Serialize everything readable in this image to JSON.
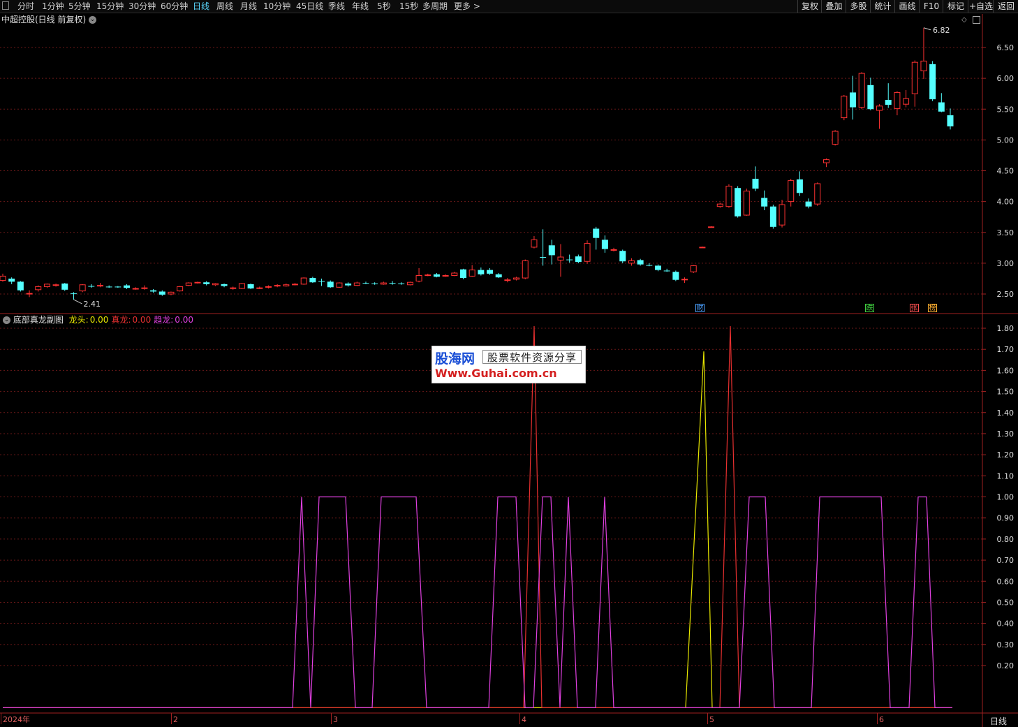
{
  "toolbar": {
    "periods": [
      "分时",
      "1分钟",
      "5分钟",
      "15分钟",
      "30分钟",
      "60分钟",
      "日线",
      "周线",
      "月线",
      "10分钟",
      "45日线",
      "季线",
      "年线",
      "5秒",
      "15秒",
      "多周期",
      "更多 >"
    ],
    "active_period": "日线",
    "right_buttons": [
      "复权",
      "叠加",
      "多股",
      "统计",
      "画线",
      "F10",
      "标记",
      "+自选",
      "返回"
    ]
  },
  "main_panel": {
    "title": "中超控股(日线 前复权)",
    "max_label": "6.82",
    "min_label": "2.41",
    "y_axis": [
      "6.50",
      "6.00",
      "5.50",
      "5.00",
      "4.50",
      "4.00",
      "3.50",
      "3.00",
      "2.50"
    ]
  },
  "sub_panel": {
    "title": "底部真龙副图",
    "indicators": [
      {
        "label": "龙头:",
        "value": "0.00",
        "color": "#e8e800"
      },
      {
        "label": "真龙:",
        "value": "0.00",
        "color": "#e83030"
      },
      {
        "label": "趋龙:",
        "value": "0.00",
        "color": "#e040e0"
      }
    ],
    "y_axis": [
      "1.80",
      "1.70",
      "1.60",
      "1.50",
      "1.40",
      "1.30",
      "1.20",
      "1.10",
      "1.00",
      "0.90",
      "0.80",
      "0.70",
      "0.60",
      "0.50",
      "0.40",
      "0.30",
      "0.20"
    ]
  },
  "badges": [
    {
      "text": "财",
      "color": "#4aa0ff"
    },
    {
      "text": "跌",
      "color": "#40d040"
    },
    {
      "text": "张",
      "color": "#ff5050"
    },
    {
      "text": "榜",
      "color": "#ffb030"
    }
  ],
  "date_axis": [
    "2024年",
    "2",
    "3",
    "4",
    "5",
    "6"
  ],
  "date_axis_right": "日线",
  "watermark": {
    "brand": "股海网",
    "slogan": "股票软件资源分享",
    "url": "Www.Guhai.com.cn"
  },
  "chart_data": [
    {
      "type": "candlestick",
      "title": "中超控股(日线 前复权)",
      "ylim": [
        2.2,
        6.9
      ],
      "candles": [
        {
          "o": 2.72,
          "c": 2.79,
          "h": 2.83,
          "l": 2.7
        },
        {
          "o": 2.75,
          "c": 2.7,
          "h": 2.77,
          "l": 2.66
        },
        {
          "o": 2.7,
          "c": 2.56,
          "h": 2.71,
          "l": 2.54
        },
        {
          "o": 2.5,
          "c": 2.51,
          "h": 2.56,
          "l": 2.45
        },
        {
          "o": 2.57,
          "c": 2.62,
          "h": 2.64,
          "l": 2.54
        },
        {
          "o": 2.62,
          "c": 2.66,
          "h": 2.67,
          "l": 2.6
        },
        {
          "o": 2.64,
          "c": 2.65,
          "h": 2.67,
          "l": 2.62
        },
        {
          "o": 2.67,
          "c": 2.57,
          "h": 2.68,
          "l": 2.55
        },
        {
          "o": 2.51,
          "c": 2.5,
          "h": 2.53,
          "l": 2.41
        },
        {
          "o": 2.55,
          "c": 2.65,
          "h": 2.66,
          "l": 2.53
        },
        {
          "o": 2.63,
          "c": 2.62,
          "h": 2.66,
          "l": 2.6
        },
        {
          "o": 2.64,
          "c": 2.64,
          "h": 2.68,
          "l": 2.61
        },
        {
          "o": 2.62,
          "c": 2.61,
          "h": 2.64,
          "l": 2.6
        },
        {
          "o": 2.62,
          "c": 2.61,
          "h": 2.63,
          "l": 2.6
        },
        {
          "o": 2.64,
          "c": 2.6,
          "h": 2.66,
          "l": 2.58
        },
        {
          "o": 2.59,
          "c": 2.59,
          "h": 2.61,
          "l": 2.57
        },
        {
          "o": 2.6,
          "c": 2.6,
          "h": 2.64,
          "l": 2.57
        },
        {
          "o": 2.56,
          "c": 2.54,
          "h": 2.58,
          "l": 2.52
        },
        {
          "o": 2.54,
          "c": 2.49,
          "h": 2.56,
          "l": 2.47
        },
        {
          "o": 2.5,
          "c": 2.53,
          "h": 2.54,
          "l": 2.48
        },
        {
          "o": 2.55,
          "c": 2.62,
          "h": 2.63,
          "l": 2.54
        },
        {
          "o": 2.64,
          "c": 2.68,
          "h": 2.69,
          "l": 2.63
        },
        {
          "o": 2.69,
          "c": 2.69,
          "h": 2.7,
          "l": 2.67
        },
        {
          "o": 2.69,
          "c": 2.66,
          "h": 2.71,
          "l": 2.64
        },
        {
          "o": 2.65,
          "c": 2.67,
          "h": 2.68,
          "l": 2.63
        },
        {
          "o": 2.66,
          "c": 2.63,
          "h": 2.67,
          "l": 2.61
        },
        {
          "o": 2.6,
          "c": 2.6,
          "h": 2.62,
          "l": 2.57
        },
        {
          "o": 2.59,
          "c": 2.67,
          "h": 2.68,
          "l": 2.58
        },
        {
          "o": 2.66,
          "c": 2.59,
          "h": 2.67,
          "l": 2.58
        },
        {
          "o": 2.6,
          "c": 2.6,
          "h": 2.62,
          "l": 2.58
        },
        {
          "o": 2.61,
          "c": 2.62,
          "h": 2.64,
          "l": 2.59
        },
        {
          "o": 2.63,
          "c": 2.64,
          "h": 2.66,
          "l": 2.61
        },
        {
          "o": 2.63,
          "c": 2.65,
          "h": 2.67,
          "l": 2.62
        },
        {
          "o": 2.65,
          "c": 2.66,
          "h": 2.68,
          "l": 2.64
        },
        {
          "o": 2.66,
          "c": 2.76,
          "h": 2.77,
          "l": 2.65
        },
        {
          "o": 2.76,
          "c": 2.69,
          "h": 2.78,
          "l": 2.68
        },
        {
          "o": 2.71,
          "c": 2.7,
          "h": 2.75,
          "l": 2.63
        },
        {
          "o": 2.7,
          "c": 2.61,
          "h": 2.72,
          "l": 2.6
        },
        {
          "o": 2.61,
          "c": 2.68,
          "h": 2.69,
          "l": 2.6
        },
        {
          "o": 2.67,
          "c": 2.64,
          "h": 2.69,
          "l": 2.62
        },
        {
          "o": 2.64,
          "c": 2.68,
          "h": 2.7,
          "l": 2.63
        },
        {
          "o": 2.68,
          "c": 2.67,
          "h": 2.7,
          "l": 2.66
        },
        {
          "o": 2.67,
          "c": 2.66,
          "h": 2.69,
          "l": 2.65
        },
        {
          "o": 2.66,
          "c": 2.68,
          "h": 2.7,
          "l": 2.65
        },
        {
          "o": 2.68,
          "c": 2.67,
          "h": 2.71,
          "l": 2.65
        },
        {
          "o": 2.67,
          "c": 2.66,
          "h": 2.69,
          "l": 2.65
        },
        {
          "o": 2.65,
          "c": 2.69,
          "h": 2.7,
          "l": 2.64
        },
        {
          "o": 2.71,
          "c": 2.8,
          "h": 2.92,
          "l": 2.69
        },
        {
          "o": 2.81,
          "c": 2.81,
          "h": 2.83,
          "l": 2.79
        },
        {
          "o": 2.82,
          "c": 2.78,
          "h": 2.84,
          "l": 2.77
        },
        {
          "o": 2.79,
          "c": 2.8,
          "h": 2.82,
          "l": 2.78
        },
        {
          "o": 2.8,
          "c": 2.84,
          "h": 2.86,
          "l": 2.79
        },
        {
          "o": 2.9,
          "c": 2.76,
          "h": 2.91,
          "l": 2.74
        },
        {
          "o": 2.79,
          "c": 2.89,
          "h": 2.97,
          "l": 2.78
        },
        {
          "o": 2.89,
          "c": 2.82,
          "h": 2.93,
          "l": 2.8
        },
        {
          "o": 2.89,
          "c": 2.83,
          "h": 2.92,
          "l": 2.81
        },
        {
          "o": 2.82,
          "c": 2.77,
          "h": 2.84,
          "l": 2.76
        },
        {
          "o": 2.73,
          "c": 2.73,
          "h": 2.76,
          "l": 2.69
        },
        {
          "o": 2.74,
          "c": 2.76,
          "h": 2.78,
          "l": 2.72
        },
        {
          "o": 2.76,
          "c": 3.04,
          "h": 3.06,
          "l": 2.74
        },
        {
          "o": 3.26,
          "c": 3.38,
          "h": 3.44,
          "l": 3.24
        },
        {
          "o": 3.1,
          "c": 3.09,
          "h": 3.55,
          "l": 2.96
        },
        {
          "o": 3.29,
          "c": 3.13,
          "h": 3.38,
          "l": 2.98
        },
        {
          "o": 3.05,
          "c": 3.1,
          "h": 3.31,
          "l": 2.78
        },
        {
          "o": 3.06,
          "c": 3.05,
          "h": 3.14,
          "l": 3.01
        },
        {
          "o": 3.11,
          "c": 3.02,
          "h": 3.14,
          "l": 3.0
        },
        {
          "o": 3.03,
          "c": 3.32,
          "h": 3.37,
          "l": 2.99
        },
        {
          "o": 3.56,
          "c": 3.41,
          "h": 3.59,
          "l": 3.22
        },
        {
          "o": 3.38,
          "c": 3.23,
          "h": 3.45,
          "l": 3.17
        },
        {
          "o": 3.22,
          "c": 3.22,
          "h": 3.25,
          "l": 3.19
        },
        {
          "o": 3.2,
          "c": 3.03,
          "h": 3.22,
          "l": 3.0
        },
        {
          "o": 3.0,
          "c": 3.04,
          "h": 3.08,
          "l": 2.96
        },
        {
          "o": 3.05,
          "c": 2.98,
          "h": 3.07,
          "l": 2.96
        },
        {
          "o": 2.97,
          "c": 2.96,
          "h": 3.0,
          "l": 2.95
        },
        {
          "o": 2.96,
          "c": 2.89,
          "h": 2.98,
          "l": 2.87
        },
        {
          "o": 2.88,
          "c": 2.87,
          "h": 2.91,
          "l": 2.86
        },
        {
          "o": 2.86,
          "c": 2.73,
          "h": 2.88,
          "l": 2.71
        },
        {
          "o": 2.74,
          "c": 2.74,
          "h": 2.77,
          "l": 2.68
        },
        {
          "o": 2.86,
          "c": 2.96,
          "h": 2.97,
          "l": 2.84
        },
        {
          "o": 3.26,
          "c": 3.26,
          "h": 3.27,
          "l": 3.25
        },
        {
          "o": 3.59,
          "c": 3.59,
          "h": 3.6,
          "l": 3.58
        },
        {
          "o": 3.92,
          "c": 3.96,
          "h": 3.98,
          "l": 3.9
        },
        {
          "o": 3.92,
          "c": 4.25,
          "h": 4.28,
          "l": 3.9
        },
        {
          "o": 4.22,
          "c": 3.76,
          "h": 4.25,
          "l": 3.74
        },
        {
          "o": 3.78,
          "c": 4.17,
          "h": 4.21,
          "l": 3.77
        },
        {
          "o": 4.37,
          "c": 4.21,
          "h": 4.57,
          "l": 4.17
        },
        {
          "o": 4.06,
          "c": 3.92,
          "h": 4.18,
          "l": 3.86
        },
        {
          "o": 3.92,
          "c": 3.59,
          "h": 3.95,
          "l": 3.56
        },
        {
          "o": 3.62,
          "c": 3.95,
          "h": 4.03,
          "l": 3.58
        },
        {
          "o": 4.0,
          "c": 4.34,
          "h": 4.37,
          "l": 3.92
        },
        {
          "o": 4.36,
          "c": 4.14,
          "h": 4.49,
          "l": 4.09
        },
        {
          "o": 4.0,
          "c": 3.92,
          "h": 4.05,
          "l": 3.89
        },
        {
          "o": 3.96,
          "c": 4.29,
          "h": 4.31,
          "l": 3.93
        },
        {
          "o": 4.63,
          "c": 4.68,
          "h": 4.7,
          "l": 4.56
        },
        {
          "o": 4.93,
          "c": 5.14,
          "h": 5.16,
          "l": 4.91
        },
        {
          "o": 5.36,
          "c": 5.71,
          "h": 5.73,
          "l": 5.32
        },
        {
          "o": 5.77,
          "c": 5.53,
          "h": 6.04,
          "l": 5.33
        },
        {
          "o": 5.53,
          "c": 6.08,
          "h": 6.1,
          "l": 5.5
        },
        {
          "o": 5.89,
          "c": 5.5,
          "h": 6.01,
          "l": 5.48
        },
        {
          "o": 5.48,
          "c": 5.55,
          "h": 5.58,
          "l": 5.18
        },
        {
          "o": 5.65,
          "c": 5.57,
          "h": 5.92,
          "l": 5.52
        },
        {
          "o": 5.51,
          "c": 5.77,
          "h": 5.79,
          "l": 5.4
        },
        {
          "o": 5.58,
          "c": 5.67,
          "h": 5.81,
          "l": 5.53
        },
        {
          "o": 5.75,
          "c": 6.26,
          "h": 6.29,
          "l": 5.54
        },
        {
          "o": 6.12,
          "c": 6.28,
          "h": 6.82,
          "l": 5.99
        },
        {
          "o": 6.23,
          "c": 5.66,
          "h": 6.28,
          "l": 5.63
        },
        {
          "o": 5.61,
          "c": 5.46,
          "h": 5.76,
          "l": 5.45
        },
        {
          "o": 5.4,
          "c": 5.22,
          "h": 5.51,
          "l": 5.17
        }
      ]
    },
    {
      "type": "line",
      "title": "底部真龙副图",
      "ylim": [
        0,
        1.85
      ],
      "series": [
        {
          "name": "龙头",
          "color": "#e8e800",
          "points": [
            [
              0,
              0
            ],
            [
              978,
              0
            ],
            [
              1004,
              1.69
            ],
            [
              1016,
              0
            ],
            [
              1360,
              0
            ]
          ]
        },
        {
          "name": "真龙",
          "color": "#e83030",
          "points": [
            [
              0,
              0
            ],
            [
              746,
              0
            ],
            [
              761,
              1.81
            ],
            [
              772,
              0
            ],
            [
              1027,
              0
            ],
            [
              1042,
              1.81
            ],
            [
              1055,
              0
            ],
            [
              1360,
              0
            ]
          ]
        },
        {
          "name": "趋龙",
          "color": "#e040e0",
          "points": [
            [
              0,
              0
            ],
            [
              415,
              0
            ],
            [
              428,
              1.0
            ],
            [
              441,
              0
            ],
            [
              453,
              1.0
            ],
            [
              491,
              1.0
            ],
            [
              505,
              0
            ],
            [
              529,
              0
            ],
            [
              542,
              1.0
            ],
            [
              592,
              1.0
            ],
            [
              607,
              0
            ],
            [
              696,
              0
            ],
            [
              709,
              1.0
            ],
            [
              735,
              1.0
            ],
            [
              748,
              0
            ],
            [
              760,
              0
            ],
            [
              773,
              1.0
            ],
            [
              785,
              1.0
            ],
            [
              798,
              0
            ],
            [
              798,
              0
            ],
            [
              810,
              1.0
            ],
            [
              823,
              0
            ],
            [
              849,
              0
            ],
            [
              862,
              1.0
            ],
            [
              875,
              0
            ],
            [
              1055,
              0
            ],
            [
              1069,
              1.0
            ],
            [
              1092,
              1.0
            ],
            [
              1105,
              0
            ],
            [
              1158,
              0
            ],
            [
              1170,
              1.0
            ],
            [
              1258,
              1.0
            ],
            [
              1271,
              0
            ],
            [
              1298,
              0
            ],
            [
              1311,
              1.0
            ],
            [
              1323,
              1.0
            ],
            [
              1335,
              0
            ],
            [
              1360,
              0
            ]
          ]
        }
      ]
    }
  ]
}
